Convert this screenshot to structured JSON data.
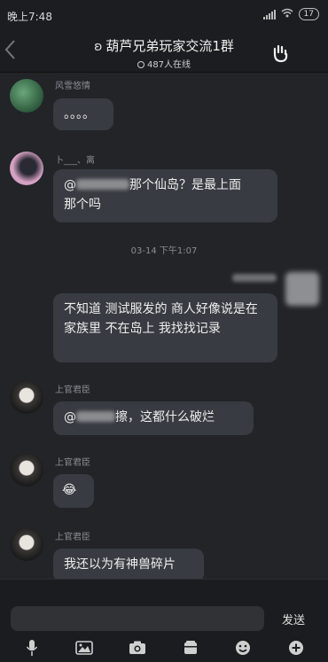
{
  "status_bar": {
    "time": "晚上7:48",
    "battery": "17"
  },
  "header": {
    "back_icon": "chevron-left-icon",
    "title": "葫芦兄弟玩家交流1群",
    "online": "487人在线"
  },
  "messages": [
    {
      "sender": "风雪悠情",
      "text": "。。。。"
    },
    {
      "sender": "卜___、离",
      "text_before": "@",
      "text_after": "那个仙岛？是最上面",
      "text_line2": "那个吗"
    },
    {
      "timestamp": "03-14 下午1:07"
    },
    {
      "sender": "",
      "text": "不知道 测试服发的 商人好像说是在家族里 不在岛上 我找找记录"
    },
    {
      "sender": "上官君臣",
      "text_before": "@",
      "text_after": "擦，这都什么破烂"
    },
    {
      "sender": "上官君臣",
      "emoji": "😂"
    },
    {
      "sender": "上官君臣",
      "text": "我还以为有神兽碎片"
    }
  ],
  "input": {
    "placeholder": "",
    "send_label": "发送"
  },
  "toolbar": [
    "mic-icon",
    "image-icon",
    "camera-icon",
    "gift-icon",
    "emoji-icon",
    "plus-icon"
  ]
}
